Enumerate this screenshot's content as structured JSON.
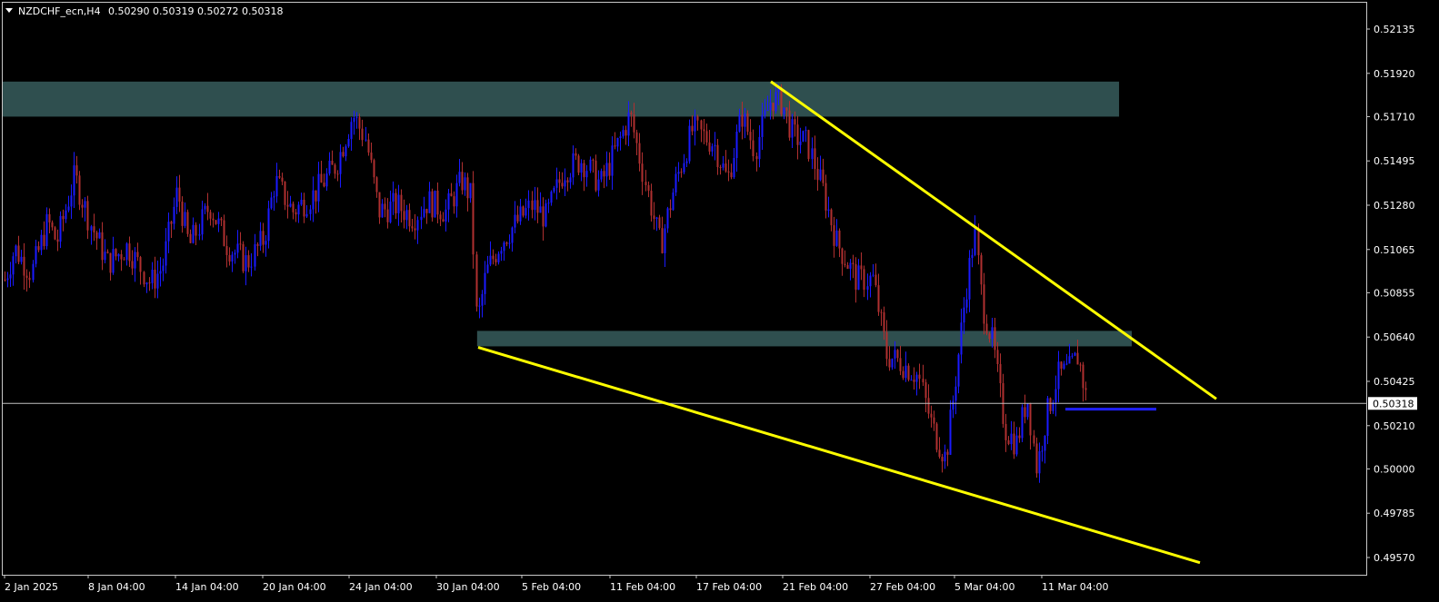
{
  "header": {
    "symbol": "NZDCHF_ecn,H4",
    "quote": "0.50290 0.50319 0.50272 0.50318"
  },
  "colors": {
    "background": "#000000",
    "frame": "#c8c8c8",
    "bull": "#1a1aff",
    "bear": "#b03030",
    "zone": "#2f4f4f",
    "trendline": "#ffff00",
    "price_line": "#c0c0c0",
    "marker": "#2020ff"
  },
  "chart_data": {
    "type": "candlestick",
    "instrument": "NZDCHF_ecn",
    "timeframe": "H4",
    "current_price": 0.50318,
    "current_price_label": "0.50318",
    "y_ticks": [
      "0.52135",
      "0.51920",
      "0.51710",
      "0.51495",
      "0.51280",
      "0.51065",
      "0.50855",
      "0.50640",
      "0.50425",
      "0.50210",
      "0.50000",
      "0.49785",
      "0.49570"
    ],
    "x_ticks": [
      "2 Jan 2025",
      "8 Jan 04:00",
      "14 Jan 04:00",
      "20 Jan 04:00",
      "24 Jan 04:00",
      "30 Jan 04:00",
      "5 Feb 04:00",
      "11 Feb 04:00",
      "17 Feb 04:00",
      "21 Feb 04:00",
      "27 Feb 04:00",
      "5 Mar 04:00",
      "11 Mar 04:00"
    ],
    "series_path": [
      [
        0,
        0.5085
      ],
      [
        16,
        0.5107
      ],
      [
        34,
        0.5095
      ],
      [
        52,
        0.512
      ],
      [
        62,
        0.511
      ],
      [
        82,
        0.5142
      ],
      [
        100,
        0.5118
      ],
      [
        118,
        0.51
      ],
      [
        140,
        0.5108
      ],
      [
        165,
        0.509
      ],
      [
        178,
        0.5098
      ],
      [
        195,
        0.5135
      ],
      [
        208,
        0.5108
      ],
      [
        230,
        0.5128
      ],
      [
        250,
        0.5108
      ],
      [
        272,
        0.51
      ],
      [
        290,
        0.5112
      ],
      [
        302,
        0.514
      ],
      [
        322,
        0.5125
      ],
      [
        344,
        0.5133
      ],
      [
        370,
        0.5148
      ],
      [
        388,
        0.5172
      ],
      [
        402,
        0.516
      ],
      [
        416,
        0.5125
      ],
      [
        436,
        0.5128
      ],
      [
        455,
        0.5122
      ],
      [
        470,
        0.513
      ],
      [
        490,
        0.5125
      ],
      [
        508,
        0.514
      ],
      [
        518,
        0.5132
      ],
      [
        524,
        0.507
      ],
      [
        534,
        0.5095
      ],
      [
        550,
        0.511
      ],
      [
        565,
        0.5118
      ],
      [
        585,
        0.5128
      ],
      [
        600,
        0.5122
      ],
      [
        620,
        0.5145
      ],
      [
        640,
        0.515
      ],
      [
        660,
        0.5138
      ],
      [
        680,
        0.5158
      ],
      [
        693,
        0.5172
      ],
      [
        708,
        0.5142
      ],
      [
        726,
        0.5108
      ],
      [
        742,
        0.5138
      ],
      [
        762,
        0.5165
      ],
      [
        785,
        0.5158
      ],
      [
        800,
        0.514
      ],
      [
        816,
        0.5172
      ],
      [
        830,
        0.5155
      ],
      [
        848,
        0.518
      ],
      [
        860,
        0.5178
      ],
      [
        872,
        0.5162
      ],
      [
        888,
        0.5158
      ],
      [
        905,
        0.5135
      ],
      [
        920,
        0.511
      ],
      [
        942,
        0.5092
      ],
      [
        960,
        0.5092
      ],
      [
        975,
        0.5055
      ],
      [
        990,
        0.5052
      ],
      [
        1010,
        0.5045
      ],
      [
        1025,
        0.502
      ],
      [
        1040,
        0.5005
      ],
      [
        1050,
        0.504
      ],
      [
        1062,
        0.5085
      ],
      [
        1072,
        0.5115
      ],
      [
        1080,
        0.508
      ],
      [
        1092,
        0.506
      ],
      [
        1105,
        0.502
      ],
      [
        1118,
        0.5012
      ],
      [
        1130,
        0.5035
      ],
      [
        1140,
        0.5
      ],
      [
        1150,
        0.5025
      ],
      [
        1163,
        0.5045
      ],
      [
        1176,
        0.5048
      ],
      [
        1186,
        0.5055
      ],
      [
        1196,
        0.5032
      ]
    ],
    "zones": [
      {
        "x0": 0.0,
        "x1": 0.8187,
        "top": 0.5188,
        "bottom": 0.5171
      },
      {
        "x0": 0.3479,
        "x1": 0.828,
        "top": 0.5067,
        "bottom": 0.50595
      }
    ],
    "trendlines": [
      {
        "p1": [
          848,
          0.5188
        ],
        "p2": [
          1338,
          0.5034
        ]
      },
      {
        "p1": [
          526,
          0.5059
        ],
        "p2": [
          1320,
          0.49545
        ]
      }
    ],
    "level_marker": {
      "p1": [
        1172,
        0.5029
      ],
      "p2": [
        1272,
        0.5029
      ]
    },
    "plot_range": {
      "xmin": 0,
      "xmax": 1503,
      "ymin": 0.49535,
      "ymax": 0.5225
    }
  }
}
